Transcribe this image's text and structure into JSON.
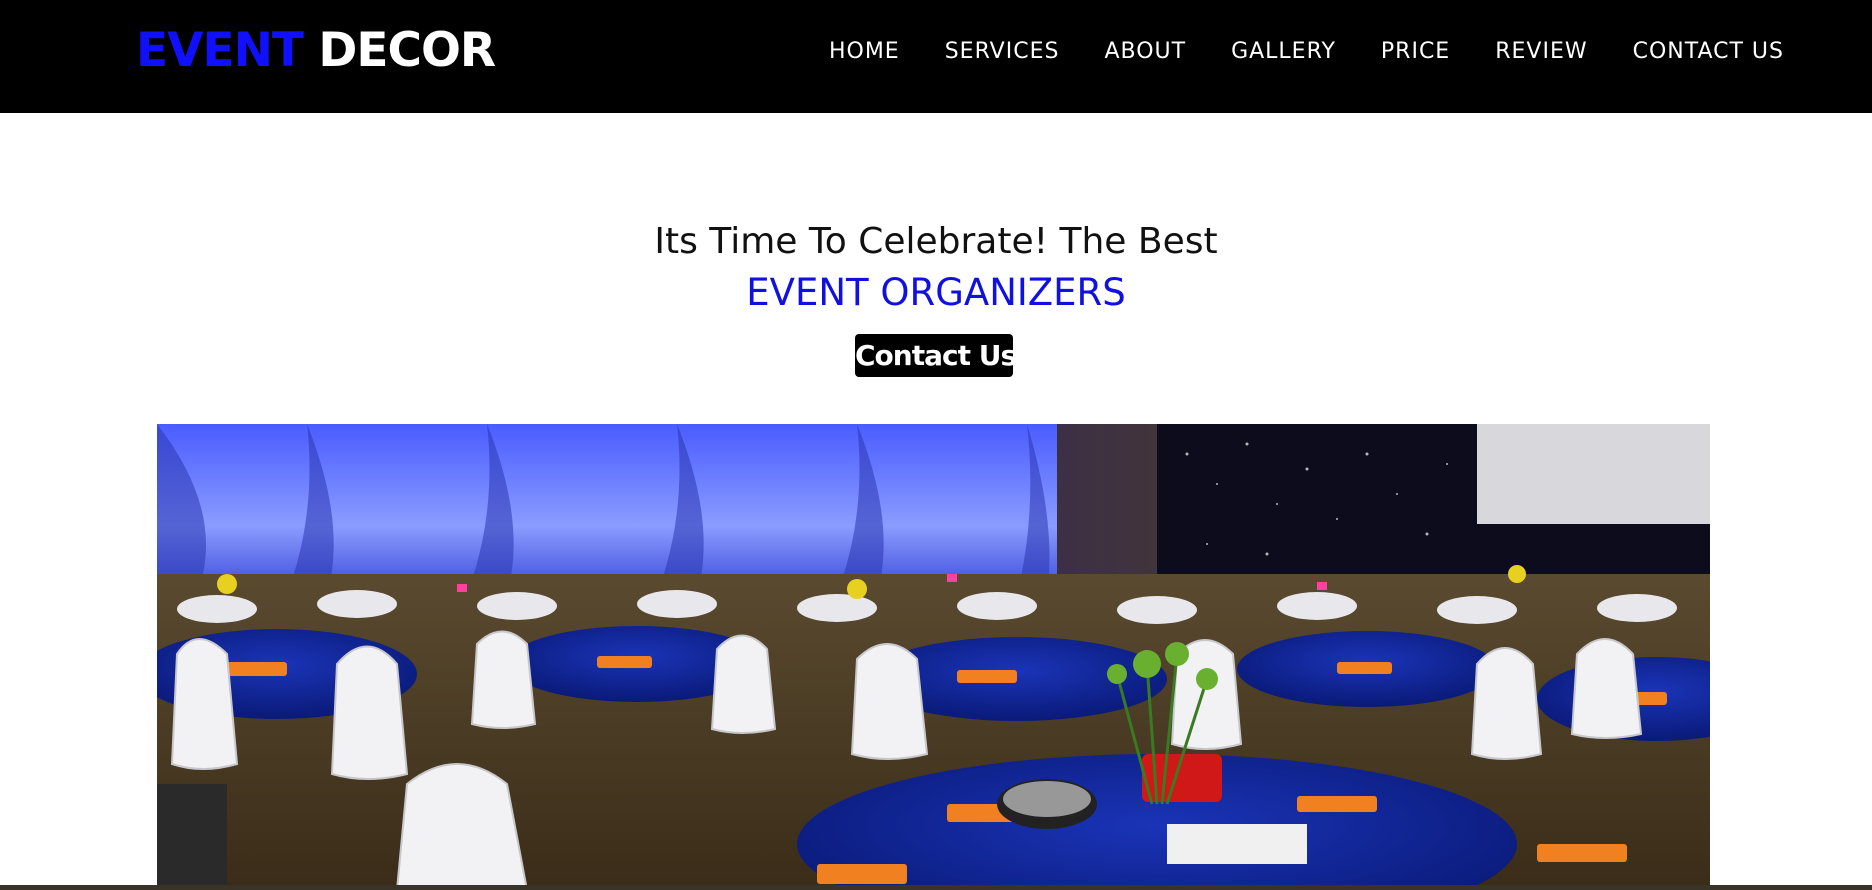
{
  "header": {
    "logo_accent": "EVENT",
    "logo_rest": " DECOR",
    "nav": [
      "HOME",
      "SERVICES",
      "ABOUT",
      "GALLERY",
      "PRICE",
      "REVIEW",
      "CONTACT US"
    ]
  },
  "hero": {
    "line1": "Its Time To Celebrate! The Best",
    "line2": "EVENT ORGANIZERS",
    "cta_label": "Contact Us"
  },
  "colors": {
    "accent": "#1010ff",
    "navbar_bg": "#000000",
    "page_bg": "#ffffff"
  }
}
